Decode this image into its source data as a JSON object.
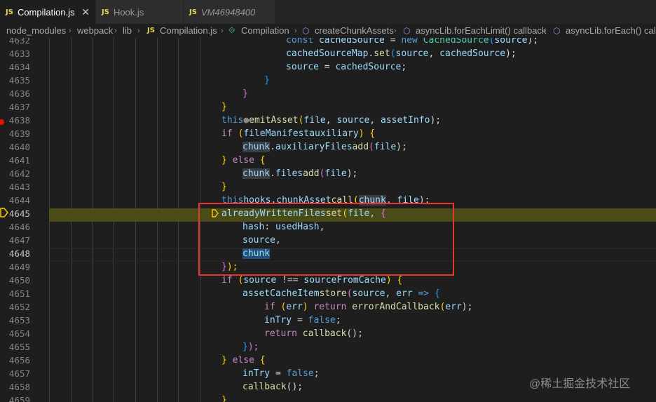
{
  "tabs": [
    {
      "badge": "JS",
      "name": "Compilation.js",
      "close": "✕"
    },
    {
      "badge": "JS",
      "name": "Hook.js"
    },
    {
      "badge": "JS",
      "name": "VM46948400"
    }
  ],
  "breadcrumb": [
    "node_modules",
    "webpack",
    "lib",
    "Compilation.js",
    "Compilation",
    "createChunkAssets",
    "asyncLib.forEachLimit() callback",
    "asyncLib.forEach() callb"
  ],
  "breadcrumb_js_badge": "JS",
  "line_numbers": [
    "4632",
    "4633",
    "4634",
    "4635",
    "4636",
    "4637",
    "4638",
    "4639",
    "4640",
    "4641",
    "4642",
    "4643",
    "4644",
    "4645",
    "4646",
    "4647",
    "4648",
    "4649",
    "4650",
    "4651",
    "4652",
    "4653",
    "4654",
    "4655",
    "4656",
    "4657",
    "4658",
    "4659"
  ],
  "code": {
    "l4632": {
      "a": "const ",
      "b": "cachedSource",
      "c": " = ",
      "d": "new ",
      "e": "CachedSource",
      "f": "(",
      "g": "source",
      "h": ");"
    },
    "l4633": {
      "a": "cachedSourceMap",
      "b": ".",
      "c": "set",
      "d": "(",
      "e": "source",
      ",": ", ",
      "f": "cachedSource",
      "g": ");"
    },
    "l4634": {
      "a": "source",
      "b": " = ",
      "c": "cachedSource",
      ";": ";"
    },
    "l4635": {
      "a": "}"
    },
    "l4636": {
      "a": "}"
    },
    "l4637": {
      "a": "}"
    },
    "l4638": {
      "a": "this",
      ".": ".",
      "dot": "●",
      "b": "emitAsset",
      "c": "(",
      "d": "file",
      ",1": ", ",
      "e": "source",
      ",2": ", ",
      "f": "assetInfo",
      "g": ");"
    },
    "l4639": {
      "a": "if ",
      "b": "(",
      "c": "fileManifest",
      ".": ".",
      "d": "auxiliary",
      "e": ") ",
      "f": "{"
    },
    "l4640": {
      "a": "chunk",
      "b": ".",
      "c": "auxiliaryFiles",
      ".": ".",
      "d": "add",
      "e": "(",
      "f": "file",
      "g": ");"
    },
    "l4641": {
      "a": "} ",
      "b": "else ",
      "c": "{"
    },
    "l4642": {
      "a": "chunk",
      "b": ".",
      "c": "files",
      ".": ".",
      "d": "add",
      "e": "(",
      "f": "file",
      "g": ");"
    },
    "l4643": {
      "a": "}"
    },
    "l4644": {
      "a": "this",
      ".": ".",
      "b": "hooks",
      "c": ".",
      "d": "chunkAsset",
      ".2": ".",
      "e": "call",
      "f": "(",
      "g": "chunk",
      ",": ", ",
      "h": "file",
      "i": ");"
    },
    "l4645": {
      "a": "alreadyWrittenFiles",
      ".": ".",
      "b": "set",
      "c": "(",
      "d": "file",
      ",": ", ",
      "e": "{"
    },
    "l4646": {
      "a": "hash",
      ":": ": ",
      "b": "usedHash",
      ",": ","
    },
    "l4647": {
      "a": "source",
      ",": ","
    },
    "l4648": {
      "a": "chunk"
    },
    "l4649": {
      "a": "}",
      "b": ");"
    },
    "l4650": {
      "a": "if ",
      "b": "(",
      "c": "source",
      "d": " !== ",
      "e": "sourceFromCache",
      "f": ") ",
      "g": "{"
    },
    "l4651": {
      "a": "assetCacheItem",
      ".": ".",
      "b": "store",
      "c": "(",
      "d": "source",
      ",": ", ",
      "e": "err",
      "f": " => ",
      "g": "{"
    },
    "l4652": {
      "a": "if ",
      "b": "(",
      "c": "err",
      "d": ") ",
      "e": "return ",
      "f": "errorAndCallback",
      "g": "(",
      "h": "err",
      "i": ");"
    },
    "l4653": {
      "a": "inTry",
      "b": " = ",
      "c": "false",
      ";": ";"
    },
    "l4654": {
      "a": "return ",
      "b": "callback",
      "c": "();"
    },
    "l4655": {
      "a": "}",
      "b": ");"
    },
    "l4656": {
      "a": "} ",
      "b": "else ",
      "c": "{"
    },
    "l4657": {
      "a": "inTry",
      "b": " = ",
      "c": "false",
      ";": ";"
    },
    "l4658": {
      "a": "callback",
      "b": "();"
    },
    "l4659": {
      "a": "}"
    }
  },
  "watermark": "@稀土掘金技术社区",
  "colors": {
    "highlight": "#4b4b18",
    "box": "#e8332e",
    "breakpoint": "#e51400"
  }
}
